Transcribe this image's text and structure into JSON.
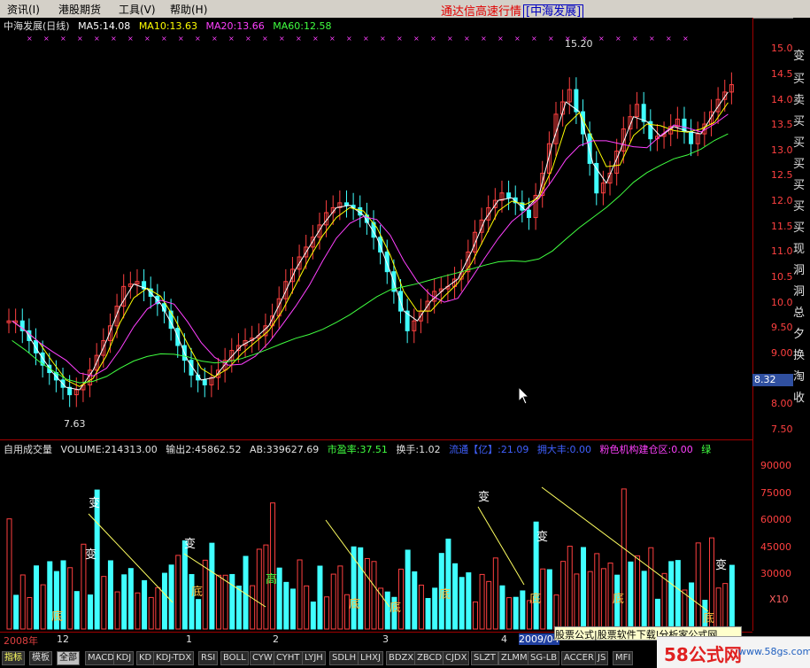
{
  "menu": {
    "items": [
      "资讯(I)",
      "港股期货",
      "工具(V)",
      "帮助(H)"
    ],
    "app_title": "通达信高速行情",
    "app_stock": "[中海发展]"
  },
  "main": {
    "stock_label": "中海发展(日线)",
    "ma5": "MA5:14.08",
    "ma10": "MA10:13.63",
    "ma20": "MA20:13.66",
    "ma60": "MA60:12.58",
    "high_label": "15.20",
    "low_label": "7.63",
    "current_price": "8.32"
  },
  "price_axis": [
    "15.00",
    "14.50",
    "14.00",
    "13.50",
    "13.00",
    "12.50",
    "12.00",
    "11.50",
    "11.00",
    "10.50",
    "10.00",
    "9.50",
    "9.00",
    "8.00",
    "7.50"
  ],
  "vol_axis": [
    "90000",
    "75000",
    "60000",
    "45000",
    "30000",
    "X10"
  ],
  "indicator": {
    "name": "自用成交量",
    "volume": "VOLUME:214313.00",
    "out2": "输出2:45862.52",
    "ab": "AB:339627.69",
    "pe": "市盈率:37.51",
    "turnover": "换手:1.02",
    "float": "流通【亿】:21.09",
    "big_buyer": "拥大丰:0.00",
    "pink": "粉色机构建仓区:0.00",
    "green": "绿"
  },
  "vertical_words": [
    "变",
    "买",
    "卖",
    "买",
    "买",
    "买",
    "买",
    "买",
    "买",
    "现",
    "洞",
    "洞",
    "总",
    "夕",
    "换",
    "淘",
    "收"
  ],
  "annotations": {
    "bian": "变",
    "di": "底",
    "gao": "高"
  },
  "date_axis": [
    {
      "label": "2008年"
    },
    {
      "label": "12"
    },
    {
      "label": "1"
    },
    {
      "label": "2"
    },
    {
      "label": "3"
    },
    {
      "label": "4"
    },
    {
      "label": "2009/04"
    }
  ],
  "tabs": [
    "指标",
    "模板",
    "全部",
    "MACD",
    "KDJ",
    "KD",
    "KDJ-TDX",
    "RSI",
    "BOLL",
    "CYW",
    "CYHT",
    "LYJH",
    "SDLH",
    "LHXJ",
    "BDZX",
    "ZBCD",
    "CJDX",
    "SLZT",
    "ZLMM",
    "SG-LB",
    "ACCER",
    "JS",
    "MFI"
  ],
  "watermark": {
    "text": "股票公式|股票软件下载|分析家公式网",
    "brand": "58公式网",
    "url": "www.58gs.com"
  },
  "chart_data": {
    "type": "candlestick",
    "price_ylim": [
      7.3,
      15.4
    ],
    "high": 15.2,
    "low": 7.63,
    "close_series_approx": [
      9.6,
      9.2,
      8.7,
      8.4,
      8.1,
      8.3,
      8.9,
      9.5,
      10.3,
      10.4,
      10.1,
      9.8,
      9.1,
      8.5,
      8.3,
      8.6,
      9.0,
      9.2,
      9.3,
      9.7,
      10.4,
      10.9,
      11.3,
      11.8,
      12.0,
      11.9,
      11.6,
      11.0,
      10.2,
      9.4,
      9.8,
      10.2,
      10.3,
      10.6,
      11.4,
      11.9,
      12.2,
      12.0,
      11.7,
      12.6,
      13.8,
      14.3,
      13.4,
      12.2,
      12.6,
      13.5,
      14.0,
      13.3,
      13.4,
      13.7,
      13.2,
      13.6,
      14.1,
      14.4
    ],
    "vol_ylim": [
      0,
      95000
    ]
  }
}
